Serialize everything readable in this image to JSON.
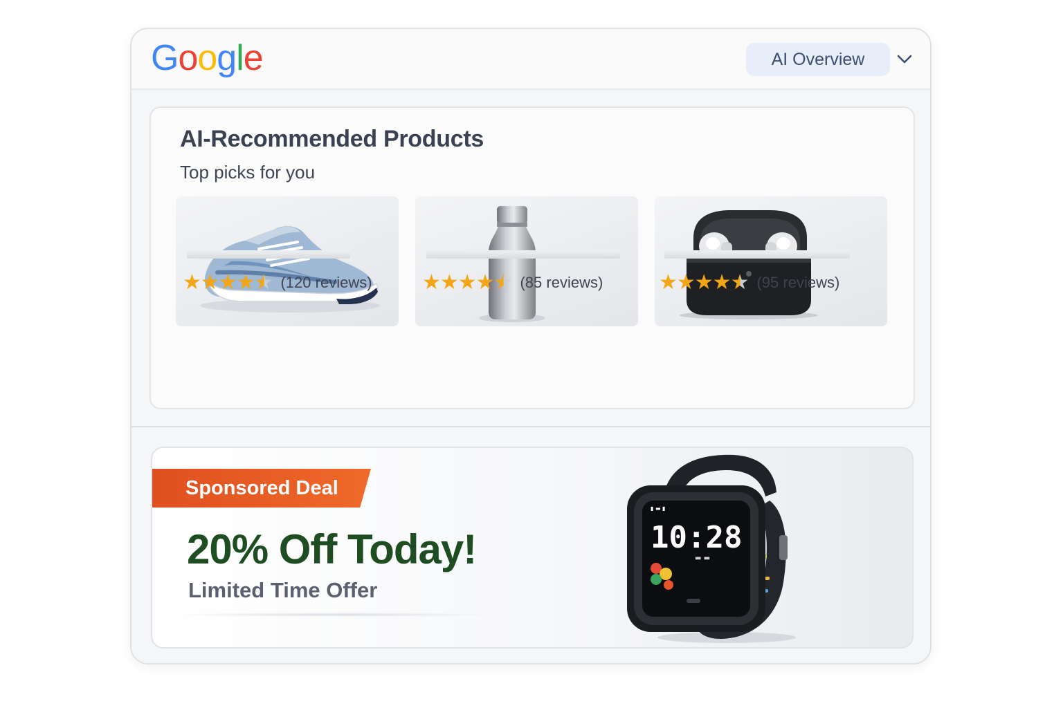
{
  "header": {
    "logo_text": "Google",
    "logo_colors": [
      "#4285F4",
      "#EA4335",
      "#FBBC05",
      "#4285F4",
      "#34A853",
      "#EA4335"
    ],
    "ai_overview_label": "AI Overview"
  },
  "recommended": {
    "title": "AI-Recommended Products",
    "subtitle": "Top picks for you",
    "products": [
      {
        "image_icon": "sneaker-icon",
        "rating": 4.5,
        "reviews": "(120 reviews)"
      },
      {
        "image_icon": "water-bottle-icon",
        "rating": 4.5,
        "reviews": "(85 reviews)"
      },
      {
        "image_icon": "earbuds-case-icon",
        "rating": 4.5,
        "reviews": "(95 reviews)"
      }
    ]
  },
  "promo": {
    "badge": "Sponsored Deal",
    "headline": "20% Off Today!",
    "subline": "Limited Time Offer",
    "watch_time": "10:28",
    "badge_color": "#E4531F",
    "headline_color": "#1F4D22"
  }
}
